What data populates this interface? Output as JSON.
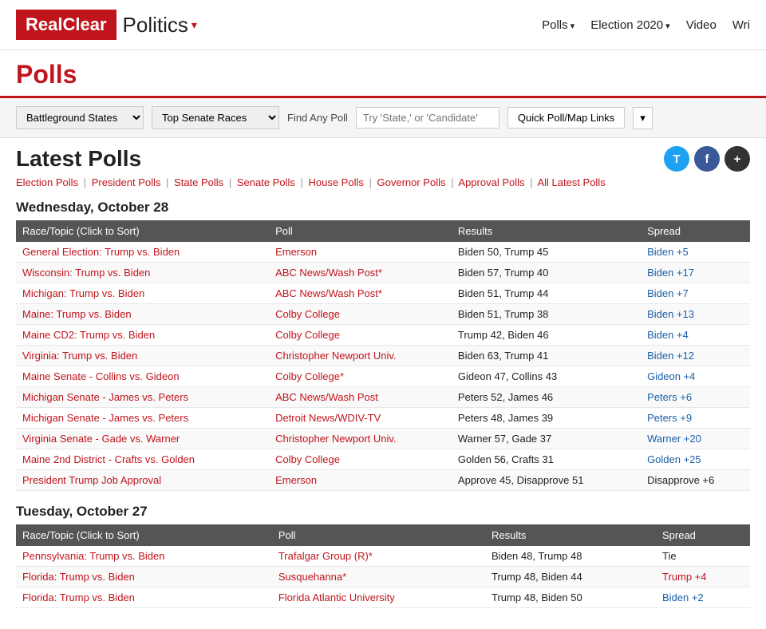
{
  "header": {
    "logo_red": "RealClear",
    "logo_black": "Politics",
    "logo_arrow": "▾",
    "nav": [
      {
        "label": "Polls",
        "has_arrow": true
      },
      {
        "label": "Election 2020",
        "has_arrow": true
      },
      {
        "label": "Video",
        "has_arrow": false
      },
      {
        "label": "Wri",
        "has_arrow": false
      }
    ]
  },
  "page_title": "Polls",
  "filter_bar": {
    "dropdown1_selected": "Battleground States",
    "dropdown1_options": [
      "Battleground States"
    ],
    "dropdown2_selected": "Top Senate Races",
    "dropdown2_options": [
      "Top Senate Races"
    ],
    "find_label": "Find Any Poll",
    "find_placeholder": "Try 'State,' or 'Candidate'",
    "quick_btn": "Quick Poll/Map Links",
    "quick_arrow": "▾"
  },
  "latest_polls": {
    "title": "Latest Polls",
    "social": [
      "T",
      "f",
      "+"
    ],
    "nav_links": [
      "Election Polls",
      "President Polls",
      "State Polls",
      "Senate Polls",
      "House Polls",
      "Governor Polls",
      "Approval Polls",
      "All Latest Polls"
    ],
    "days": [
      {
        "label": "Wednesday, October 28",
        "columns": [
          "Race/Topic  (Click to Sort)",
          "Poll",
          "Results",
          "Spread"
        ],
        "rows": [
          {
            "race": "General Election: Trump vs. Biden",
            "poll": "Emerson",
            "results": "Biden 50, Trump 45",
            "spread": "Biden +5",
            "spread_class": "spread-biden"
          },
          {
            "race": "Wisconsin: Trump vs. Biden",
            "poll": "ABC News/Wash Post*",
            "results": "Biden 57, Trump 40",
            "spread": "Biden +17",
            "spread_class": "spread-biden"
          },
          {
            "race": "Michigan: Trump vs. Biden",
            "poll": "ABC News/Wash Post*",
            "results": "Biden 51, Trump 44",
            "spread": "Biden +7",
            "spread_class": "spread-biden"
          },
          {
            "race": "Maine: Trump vs. Biden",
            "poll": "Colby College",
            "results": "Biden 51, Trump 38",
            "spread": "Biden +13",
            "spread_class": "spread-biden"
          },
          {
            "race": "Maine CD2: Trump vs. Biden",
            "poll": "Colby College",
            "results": "Trump 42, Biden 46",
            "spread": "Biden +4",
            "spread_class": "spread-biden"
          },
          {
            "race": "Virginia: Trump vs. Biden",
            "poll": "Christopher Newport Univ.",
            "results": "Biden 63, Trump 41",
            "spread": "Biden +12",
            "spread_class": "spread-biden"
          },
          {
            "race": "Maine Senate - Collins vs. Gideon",
            "poll": "Colby College*",
            "results": "Gideon 47, Collins 43",
            "spread": "Gideon +4",
            "spread_class": "spread-gideon"
          },
          {
            "race": "Michigan Senate - James vs. Peters",
            "poll": "ABC News/Wash Post",
            "results": "Peters 52, James 46",
            "spread": "Peters +6",
            "spread_class": "spread-peters"
          },
          {
            "race": "Michigan Senate - James vs. Peters",
            "poll": "Detroit News/WDIV-TV",
            "results": "Peters 48, James 39",
            "spread": "Peters +9",
            "spread_class": "spread-peters"
          },
          {
            "race": "Virginia Senate - Gade vs. Warner",
            "poll": "Christopher Newport Univ.",
            "results": "Warner 57, Gade 37",
            "spread": "Warner +20",
            "spread_class": "spread-warner"
          },
          {
            "race": "Maine 2nd District - Crafts vs. Golden",
            "poll": "Colby College",
            "results": "Golden 56, Crafts 31",
            "spread": "Golden +25",
            "spread_class": "spread-golden"
          },
          {
            "race": "President Trump Job Approval",
            "poll": "Emerson",
            "results": "Approve 45, Disapprove 51",
            "spread": "Disapprove +6",
            "spread_class": "spread-neutral"
          }
        ]
      },
      {
        "label": "Tuesday, October 27",
        "columns": [
          "Race/Topic  (Click to Sort)",
          "Poll",
          "Results",
          "Spread"
        ],
        "rows": [
          {
            "race": "Pennsylvania: Trump vs. Biden",
            "poll": "Trafalgar Group (R)*",
            "results": "Biden 48, Trump 48",
            "spread": "Tie",
            "spread_class": "spread-neutral"
          },
          {
            "race": "Florida: Trump vs. Biden",
            "poll": "Susquehanna*",
            "results": "Trump 48, Biden 44",
            "spread": "Trump +4",
            "spread_class": "spread-trump"
          },
          {
            "race": "Florida: Trump vs. Biden",
            "poll": "Florida Atlantic University",
            "results": "Trump 48, Biden 50",
            "spread": "Biden +2",
            "spread_class": "spread-biden"
          }
        ]
      }
    ]
  }
}
